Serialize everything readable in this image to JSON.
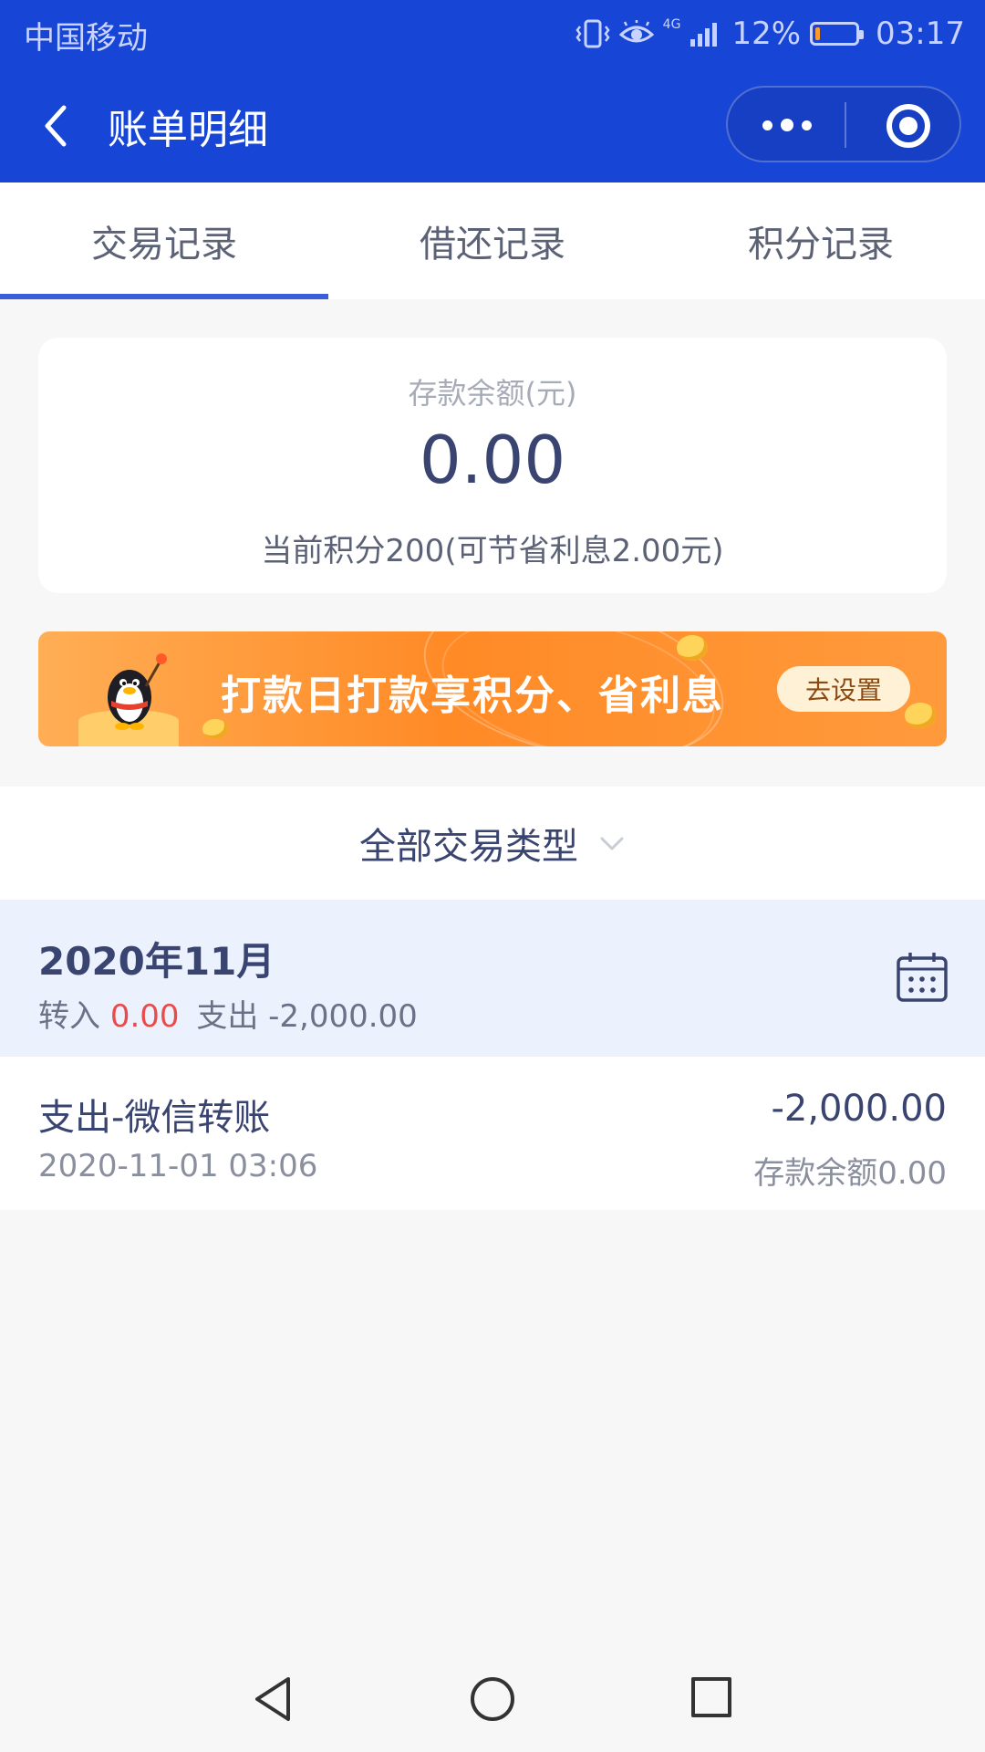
{
  "status_bar": {
    "carrier": "中国移动",
    "network": "4G",
    "battery": "12%",
    "battery_level": 0.12,
    "time": "03:17"
  },
  "header": {
    "title": "账单明细",
    "icons": [
      "back-arrow-icon",
      "more-dots-icon",
      "target-circle-icon"
    ]
  },
  "tabs": [
    {
      "label": "交易记录",
      "active": true
    },
    {
      "label": "借还记录",
      "active": false
    },
    {
      "label": "积分记录",
      "active": false
    }
  ],
  "balance_card": {
    "label": "存款余额(元)",
    "amount": "0.00",
    "points_info": "当前积分200(可节省利息2.00元)"
  },
  "banner": {
    "text": "打款日打款享积分、省利息",
    "button_label": "去设置"
  },
  "filter": {
    "label": "全部交易类型"
  },
  "month_group": {
    "title": "2020年11月",
    "in_label": "转入",
    "in_value": "0.00",
    "out_label": "支出",
    "out_value": "-2,000.00"
  },
  "transactions": [
    {
      "title": "支出-微信转账",
      "time": "2020-11-01 03:06",
      "amount": "-2,000.00",
      "balance": "存款余额0.00"
    }
  ],
  "colors": {
    "primary": "#1746d6",
    "tab_indicator": "#3a5fd8",
    "income_red": "#e94b4b",
    "banner_orange": "#ff8a26"
  }
}
